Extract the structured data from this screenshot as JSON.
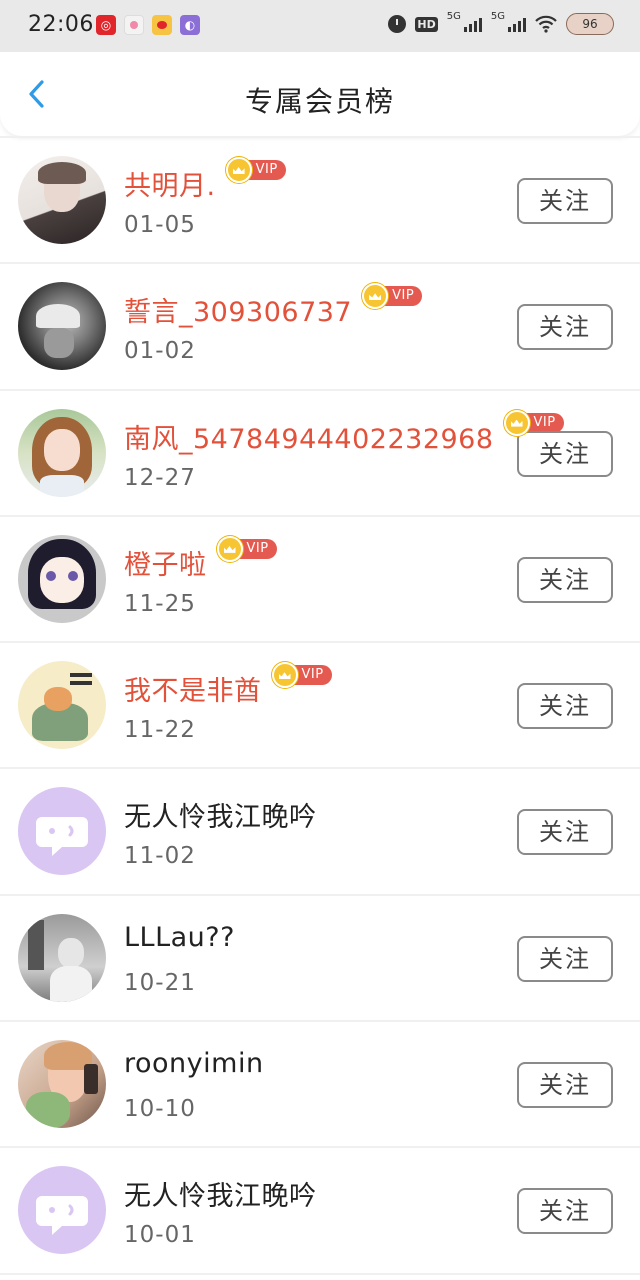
{
  "status_bar": {
    "time": "22:06",
    "hd": "HD",
    "net1": "5G",
    "net2": "5G",
    "battery": "96",
    "icons": [
      "netease-music-icon",
      "app-icon",
      "weibo-icon",
      "app-icon-purple",
      "alarm-icon",
      "signal-icon",
      "wifi-icon",
      "battery-icon"
    ]
  },
  "header": {
    "title": "专属会员榜",
    "back_icon": "chevron-left-icon"
  },
  "vip_label": "VIP",
  "follow_label": "关注",
  "members": [
    {
      "name": "共明月.",
      "date": "01-05",
      "vip": true
    },
    {
      "name": "誓言_309306737",
      "date": "01-02",
      "vip": true
    },
    {
      "name": "南风_54784944402232968",
      "date": "12-27",
      "vip": true
    },
    {
      "name": "橙子啦",
      "date": "11-25",
      "vip": true
    },
    {
      "name": "我不是非酋",
      "date": "11-22",
      "vip": true
    },
    {
      "name": "无人怜我江晚吟",
      "date": "11-02",
      "vip": false
    },
    {
      "name": "LLLau??",
      "date": "10-21",
      "vip": false
    },
    {
      "name": "roonyimin",
      "date": "10-10",
      "vip": false
    },
    {
      "name": "无人怜我江晚吟",
      "date": "10-01",
      "vip": false
    }
  ],
  "colors": {
    "accent_blue": "#2f9be8",
    "vip_name": "#e2513a",
    "vip_badge": "#e55a50",
    "crown": "#f6c531"
  }
}
